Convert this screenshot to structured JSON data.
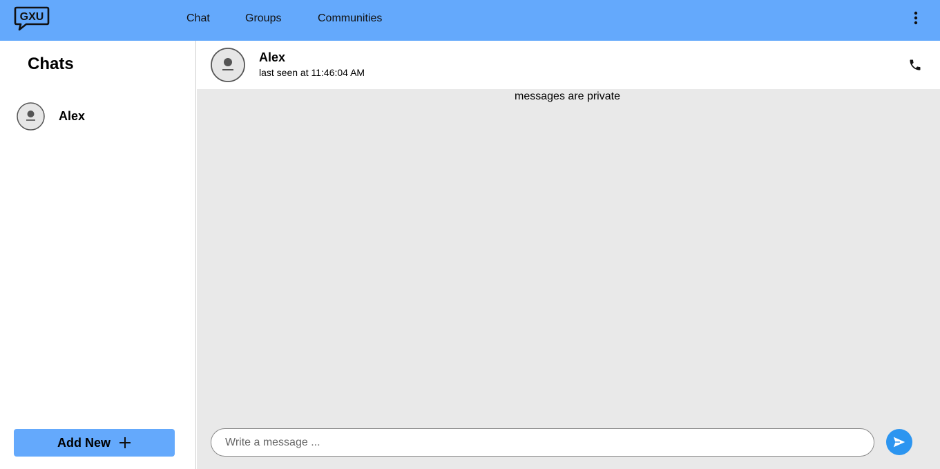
{
  "app": {
    "logo_text": "GXU"
  },
  "nav": {
    "chat": "Chat",
    "groups": "Groups",
    "communities": "Communities"
  },
  "sidebar": {
    "title": "Chats",
    "chats": [
      {
        "name": "Alex"
      }
    ],
    "add_new_label": "Add New"
  },
  "conversation": {
    "contact_name": "Alex",
    "last_seen": "last seen at 11:46:04 AM",
    "privacy_note": "messages are private"
  },
  "composer": {
    "placeholder": "Write a message ...",
    "value": ""
  },
  "colors": {
    "topbar": "#64a9fc",
    "send_button": "#2c95f0",
    "messages_bg": "#e9e9e9"
  },
  "icons": {
    "menu": "kebab-menu-icon",
    "call": "phone-icon",
    "send": "send-icon",
    "add": "plus-icon",
    "avatar": "user-avatar-icon"
  }
}
